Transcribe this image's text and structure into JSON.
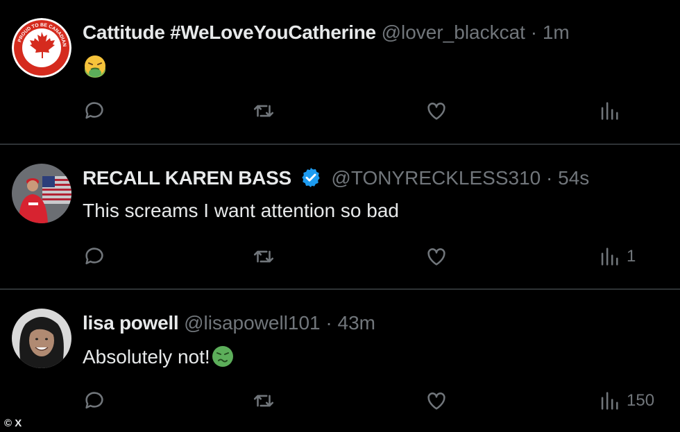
{
  "colors": {
    "background": "#000000",
    "text_primary": "#e7e9ea",
    "text_secondary": "#71767b",
    "divider": "#2f3336",
    "verified_blue": "#1d9bf0",
    "emoji_green": "#5cae5a"
  },
  "tweets": [
    {
      "display_name": "Cattitude #WeLoveYouCatherine",
      "handle": "@lover_blackcat",
      "separator": "·",
      "time": "1m",
      "verified": false,
      "avatar": "proud-to-be-canadian-badge",
      "body": "",
      "emoji": "nauseated-face",
      "stats": {
        "replies": "",
        "retweets": "",
        "likes": "",
        "views": ""
      }
    },
    {
      "display_name": "RECALL KAREN BASS",
      "handle": "@TONYRECKLESS310",
      "separator": "·",
      "time": "54s",
      "verified": true,
      "avatar": "person-with-flag-photo",
      "body": "This screams I want attention so bad",
      "stats": {
        "replies": "",
        "retweets": "",
        "likes": "",
        "views": "1"
      }
    },
    {
      "display_name": "lisa powell",
      "handle": "@lisapowell101",
      "separator": "·",
      "time": "43m",
      "verified": false,
      "avatar": "smiling-woman-photo",
      "body": "Absolutely not!",
      "emoji": "nauseated-face",
      "stats": {
        "replies": "",
        "retweets": "",
        "likes": "",
        "views": "150"
      }
    }
  ],
  "watermark": "© X"
}
